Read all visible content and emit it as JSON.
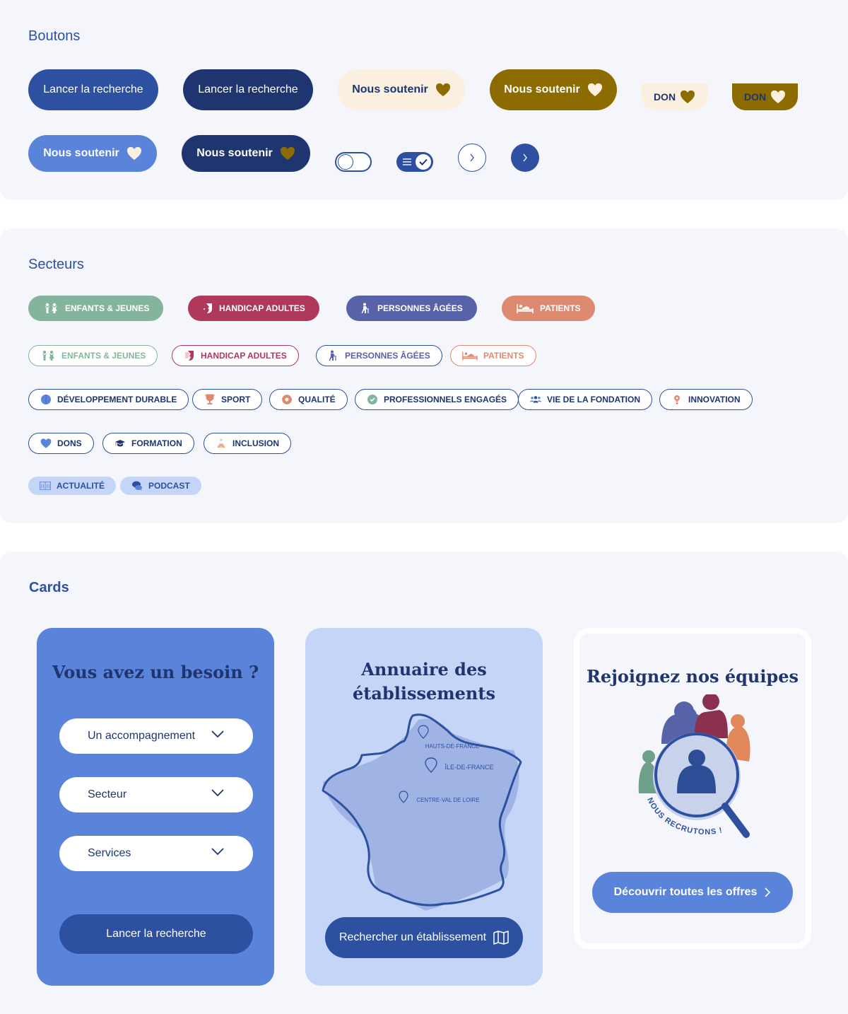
{
  "sections": {
    "buttons": {
      "title": "Boutons"
    },
    "sectors": {
      "title": "Secteurs"
    },
    "cards": {
      "title": "Cards"
    }
  },
  "buttons": {
    "search_primary": "Lancer la recherche",
    "search_dark": "Lancer la recherche",
    "support_light": "Nous soutenir",
    "support_gold": "Nous soutenir",
    "don_light": "DON",
    "don_gold": "DON",
    "support_blue": "Nous soutenir",
    "support_navy": "Nous soutenir"
  },
  "toggles": {
    "off_state": "off",
    "on_state": "on"
  },
  "sectors_filled": [
    {
      "label": "Enfants & jeunes",
      "icon": "children-icon",
      "color": "#84b59c"
    },
    {
      "label": "Handicap adultes",
      "icon": "face-icon",
      "color": "#b0385a"
    },
    {
      "label": "Personnes âgées",
      "icon": "elderly-icon",
      "color": "#5862a8"
    },
    {
      "label": "Patients",
      "icon": "bed-icon",
      "color": "#de8a71"
    }
  ],
  "sectors_outline": [
    {
      "label": "Enfants & jeunes",
      "icon": "children-icon",
      "color": "#84b59c"
    },
    {
      "label": "Handicap adultes",
      "icon": "face-icon",
      "color": "#b0385a"
    },
    {
      "label": "Personnes âgées",
      "icon": "elderly-icon",
      "color": "#2d51a0"
    },
    {
      "label": "Patients",
      "icon": "bed-icon",
      "color": "#de8a71"
    }
  ],
  "topics": [
    {
      "label": "Développement durable",
      "icon": "globe-icon"
    },
    {
      "label": "Sport",
      "icon": "trophy-icon"
    },
    {
      "label": "Qualité",
      "icon": "gear-badge-icon"
    },
    {
      "label": "Professionnels engagés",
      "icon": "check-badge-icon"
    },
    {
      "label": "Vie de la fondation",
      "icon": "people-icon"
    },
    {
      "label": "Innovation",
      "icon": "lightbulb-icon"
    },
    {
      "label": "Dons",
      "icon": "heart-icon"
    },
    {
      "label": "Formation",
      "icon": "graduation-cap-icon"
    },
    {
      "label": "Inclusion",
      "icon": "hands-icon"
    }
  ],
  "content_types": [
    {
      "label": "Actualité",
      "icon": "book-icon"
    },
    {
      "label": "Podcast",
      "icon": "chat-bubbles-icon"
    }
  ],
  "cards": {
    "need": {
      "title": "Vous avez un besoin ?",
      "selects": [
        "Un accompagnement",
        "Secteur",
        "Services"
      ],
      "button": "Lancer la recherche"
    },
    "directory": {
      "title_line1": "Annuaire des",
      "title_line2": "établissements",
      "regions": [
        "HAUTS-DE-FRANCE",
        "ÎLE-DE-FRANCE",
        "CENTRE-VAL DE LOIRE"
      ],
      "button": "Rechercher un établissement"
    },
    "jobs": {
      "title": "Rejoignez nos équipes",
      "badge_text": "NOUS RECRUTONS !",
      "button": "Découvrir toutes les offres"
    }
  },
  "colors": {
    "primary": "#2d51a0",
    "navy": "#1e3570",
    "light_blue": "#5a83da",
    "pale_blue": "#c5d5f7",
    "cream": "#fbf0e0",
    "gold": "#8c6b00",
    "panel_bg": "#f5f6fb"
  }
}
